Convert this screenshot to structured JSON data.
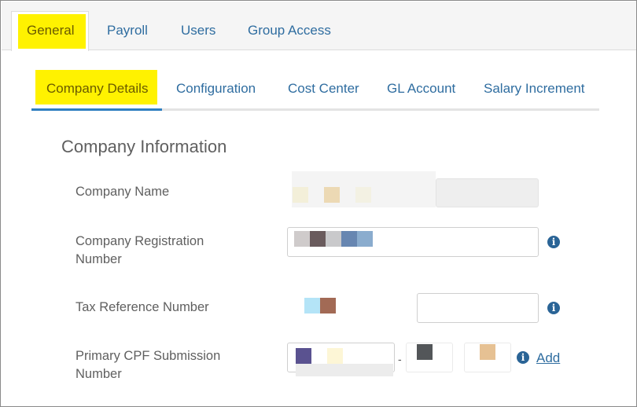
{
  "top_tabs": [
    {
      "label": "General",
      "active": true
    },
    {
      "label": "Payroll",
      "active": false
    },
    {
      "label": "Users",
      "active": false
    },
    {
      "label": "Group Access",
      "active": false
    }
  ],
  "sub_tabs": [
    {
      "label": "Company Details",
      "active": true
    },
    {
      "label": "Configuration",
      "active": false
    },
    {
      "label": "Cost Center",
      "active": false
    },
    {
      "label": "GL Account",
      "active": false
    },
    {
      "label": "Salary Increment",
      "active": false
    }
  ],
  "section": {
    "title": "Company Information"
  },
  "fields": {
    "company_name": {
      "label": "Company Name",
      "value": ""
    },
    "registration_number": {
      "label": "Company Registration Number",
      "value": ""
    },
    "tax_reference": {
      "label": "Tax Reference Number",
      "value": ""
    },
    "cpf_submission": {
      "label": "Primary CPF Submission Number",
      "value": ""
    }
  },
  "icons": {
    "info": "info-circle-icon"
  },
  "actions": {
    "add_label": "Add"
  },
  "colors": {
    "highlight": "#fff200",
    "link": "#2f6da0",
    "tab_underline": "#2f7fc1"
  }
}
